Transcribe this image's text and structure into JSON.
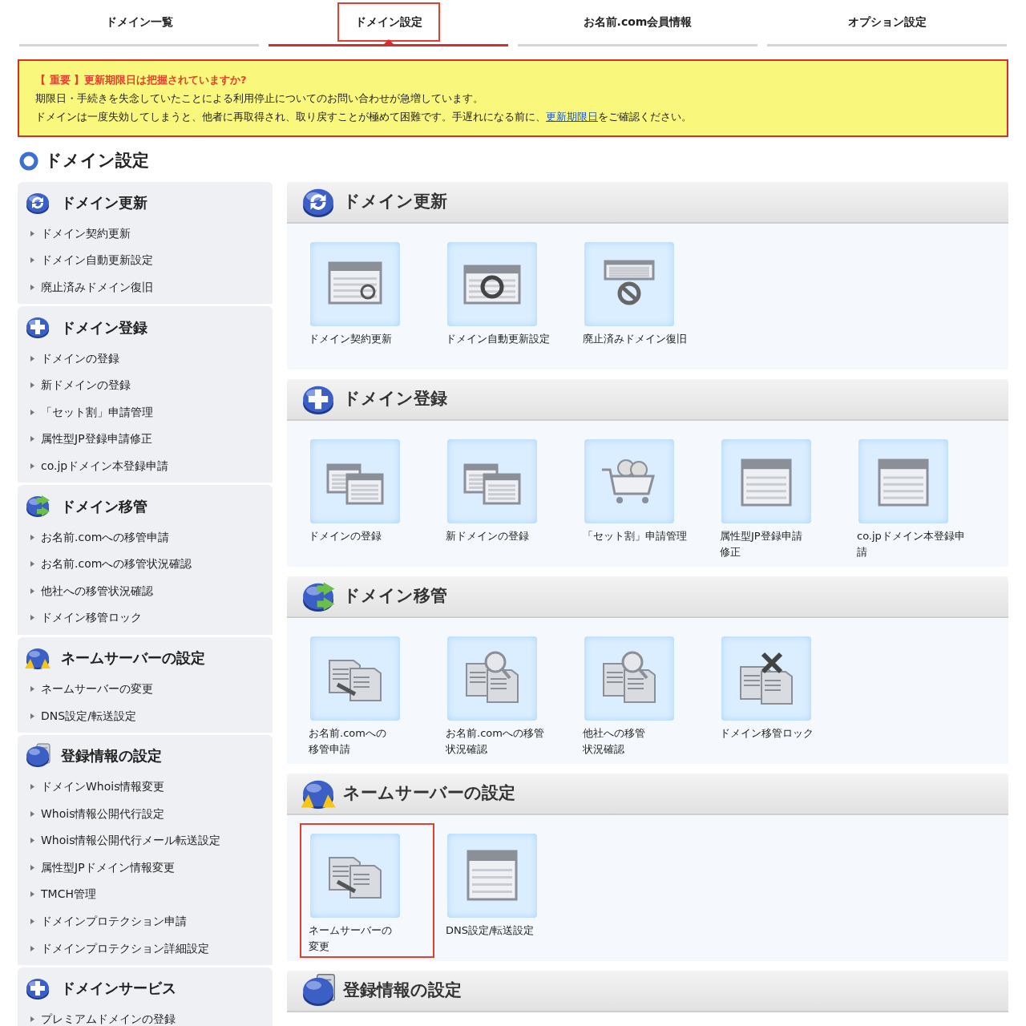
{
  "tabs": [
    {
      "label": "ドメイン一覧",
      "selected": false,
      "highlighted": false
    },
    {
      "label": "ドメイン設定",
      "selected": true,
      "highlighted": true
    },
    {
      "label": "お名前.com会員情報",
      "selected": false,
      "highlighted": false
    },
    {
      "label": "オプション設定",
      "selected": false,
      "highlighted": false
    }
  ],
  "notice": {
    "heading": "【 重要 】更新期限日は把握されていますか?",
    "line_1": "期限日・手続きを失念していたことによる利用停止についてのお問い合わせが急増しています。",
    "line_2_before": "ドメインは一度失効してしまうと、他者に再取得され、取り戻すことが極めて困難です。手遅れになる前に、",
    "line_2_link": "更新期限日",
    "line_2_after": "をご確認ください。"
  },
  "page_title": "ドメイン設定",
  "sidebar": [
    {
      "kind": "renew",
      "title": "ドメイン更新",
      "items": [
        "ドメイン契約更新",
        "ドメイン自動更新設定",
        "廃止済みドメイン復旧"
      ]
    },
    {
      "kind": "register",
      "title": "ドメイン登録",
      "items": [
        "ドメインの登録",
        "新ドメインの登録",
        "「セット割」申請管理",
        "属性型JP登録申請修正",
        "co.jpドメイン本登録申請"
      ]
    },
    {
      "kind": "transfer",
      "title": "ドメイン移管",
      "items": [
        "お名前.comへの移管申請",
        "お名前.comへの移管状況確認",
        "他社への移管状況確認",
        "ドメイン移管ロック"
      ]
    },
    {
      "kind": "nameserver",
      "title": "ネームサーバーの設定",
      "items": [
        "ネームサーバーの変更",
        "DNS設定/転送設定"
      ]
    },
    {
      "kind": "registration",
      "title": "登録情報の設定",
      "items": [
        "ドメインWhois情報変更",
        "Whois情報公開代行設定",
        "Whois情報公開代行メール転送設定",
        "属性型JPドメイン情報変更",
        "TMCH管理",
        "ドメインプロテクション申請",
        "ドメインプロテクション詳細設定"
      ]
    },
    {
      "kind": "register",
      "title": "ドメインサービス",
      "items": [
        "プレミアムドメインの登録"
      ]
    }
  ],
  "sections": [
    {
      "kind": "renew",
      "title": "ドメイン更新",
      "tiles": [
        {
          "kind": "renew-form",
          "lines": [
            "ドメイン契約更新"
          ],
          "highlighted": false
        },
        {
          "kind": "sync",
          "lines": [
            "ドメイン自動更新設定"
          ],
          "highlighted": false
        },
        {
          "kind": "restore",
          "lines": [
            "廃止済みドメイン復旧"
          ],
          "highlighted": false
        }
      ]
    },
    {
      "kind": "register",
      "title": "ドメイン登録",
      "tiles": [
        {
          "kind": "domains",
          "lines": [
            "ドメインの登録"
          ],
          "highlighted": false
        },
        {
          "kind": "domains",
          "lines": [
            "新ドメインの登録"
          ],
          "highlighted": false
        },
        {
          "kind": "cart",
          "lines": [
            "「セット割」申請管理"
          ],
          "highlighted": false
        },
        {
          "kind": "window",
          "lines": [
            "属性型JP登録申請",
            "修正"
          ],
          "highlighted": false
        },
        {
          "kind": "window",
          "lines": [
            "co.jpドメイン本登録申",
            "請"
          ],
          "highlighted": false
        }
      ]
    },
    {
      "kind": "transfer",
      "title": "ドメイン移管",
      "tiles": [
        {
          "kind": "server-move",
          "lines": [
            "お名前.comへの",
            "移管申請"
          ],
          "highlighted": false
        },
        {
          "kind": "server-search",
          "lines": [
            "お名前.comへの移管",
            "状況確認"
          ],
          "highlighted": false
        },
        {
          "kind": "server-search",
          "lines": [
            "他社への移管",
            "状況確認"
          ],
          "highlighted": false
        },
        {
          "kind": "server-lock",
          "lines": [
            "ドメイン移管ロック"
          ],
          "highlighted": false
        }
      ]
    },
    {
      "kind": "nameserver",
      "title": "ネームサーバーの設定",
      "tiles": [
        {
          "kind": "server-move",
          "lines": [
            "ネームサーバーの",
            "変更"
          ],
          "highlighted": true
        },
        {
          "kind": "list",
          "lines": [
            "DNS設定/転送設定"
          ],
          "highlighted": false
        }
      ]
    },
    {
      "kind": "registration",
      "title": "登録情報の設定"
    }
  ]
}
